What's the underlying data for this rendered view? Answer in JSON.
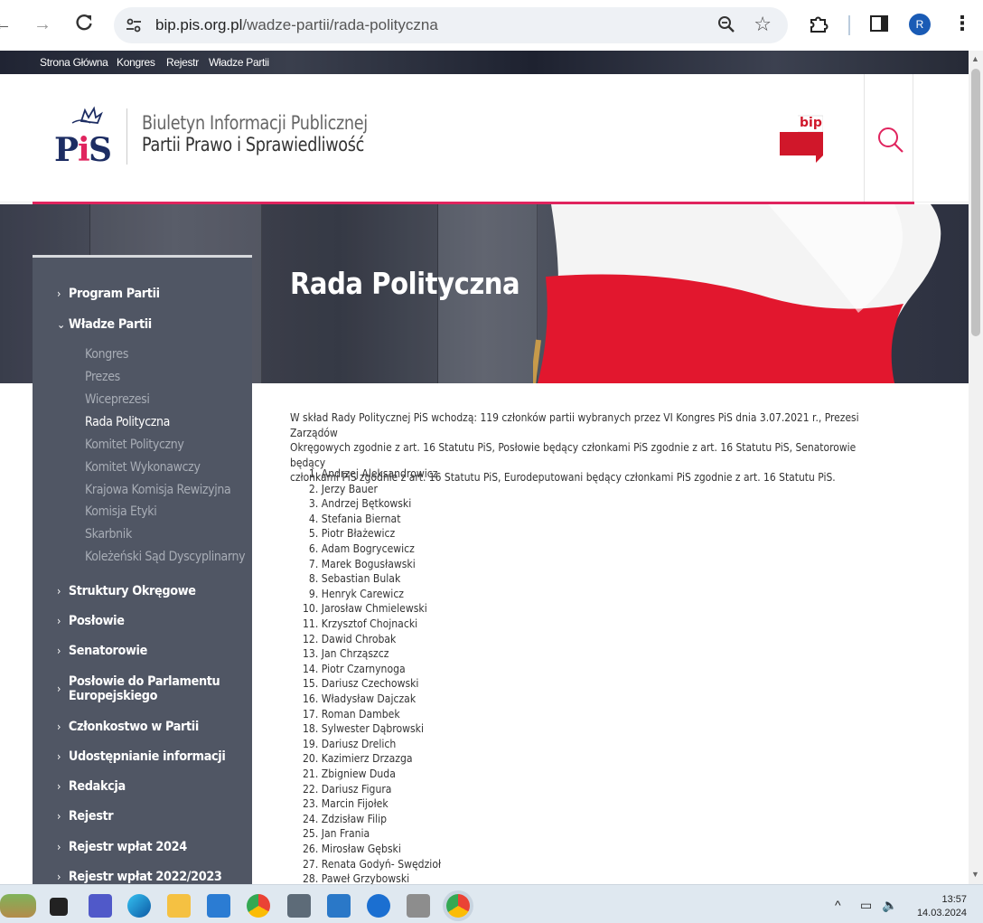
{
  "browser": {
    "url_domain": "bip.pis.org.pl",
    "url_path": "/wadze-partii/rada-polityczna",
    "profile_initial": "R"
  },
  "topnav": [
    "Strona Główna",
    "Kongres",
    "Rejestr",
    "Władze Partii"
  ],
  "header": {
    "logo_text": "PiS",
    "title_line1": "Biuletyn Informacji Publicznej",
    "title_line2": "Partii Prawo i Sprawiedliwość",
    "bip_label": "bip"
  },
  "hero": {
    "title": "Rada Polityczna"
  },
  "sidebar": {
    "items": [
      {
        "label": "Program Partii",
        "chevron": "›"
      },
      {
        "label": "Władze Partii",
        "chevron": "⌄"
      }
    ],
    "subitems": [
      {
        "label": "Kongres",
        "active": false
      },
      {
        "label": "Prezes",
        "active": false
      },
      {
        "label": "Wiceprezesi",
        "active": false
      },
      {
        "label": "Rada Polityczna",
        "active": true
      },
      {
        "label": "Komitet Polityczny",
        "active": false
      },
      {
        "label": "Komitet Wykonawczy",
        "active": false
      },
      {
        "label": "Krajowa Komisja Rewizyjna",
        "active": false
      },
      {
        "label": "Komisja Etyki",
        "active": false
      },
      {
        "label": "Skarbnik",
        "active": false
      },
      {
        "label": "Koleżeński Sąd Dyscyplinarny",
        "active": false
      }
    ],
    "items_after": [
      {
        "label": "Struktury Okręgowe"
      },
      {
        "label": "Posłowie"
      },
      {
        "label": "Senatorowie"
      },
      {
        "label": "Posłowie do Parlamentu",
        "label2": "Europejskiego"
      },
      {
        "label": "Członkostwo w Partii"
      },
      {
        "label": "Udostępnianie informacji"
      },
      {
        "label": "Redakcja"
      },
      {
        "label": "Rejestr"
      },
      {
        "label": "Rejestr wpłat 2024"
      },
      {
        "label": "Rejestr wpłat 2022/2023"
      }
    ]
  },
  "content": {
    "intro_lines": [
      "W skład Rady Politycznej PiS wchodzą: 119 członków partii wybranych przez VI Kongres PiS dnia 3.07.2021 r., Prezesi Zarządów",
      "Okręgowych zgodnie z art. 16 Statutu PiS, Posłowie będący członkami PiS zgodnie z art. 16 Statutu PiS, Senatorowie będący",
      "członkami PiS zgodnie z art. 16 Statutu PiS, Eurodeputowani będący członkami PiS zgodnie z art. 16 Statutu PiS."
    ],
    "members": [
      "Andrzej Aleksandrowicz",
      "Jerzy Bauer",
      "Andrzej Bętkowski",
      "Stefania Biernat",
      "Piotr Błażewicz",
      "Adam Bogrycewicz",
      "Marek Bogusławski",
      "Sebastian Bulak",
      "Henryk Carewicz",
      "Jarosław Chmielewski",
      "Krzysztof Chojnacki",
      "Dawid Chrobak",
      "Jan Chrząszcz",
      "Piotr Czarnynoga",
      "Dariusz Czechowski",
      "Władysław Dajczak",
      "Roman Dambek",
      "Sylwester Dąbrowski",
      "Dariusz Drelich",
      "Kazimierz Drzazga",
      "Zbigniew Duda",
      "Dariusz Figura",
      "Marcin Fijołek",
      "Zdzisław Filip",
      "Jan Frania",
      "Mirosław Gębski",
      "Renata Godyń- Swędzioł",
      "Paweł Grzybowski"
    ]
  },
  "taskbar": {
    "time": "13:57",
    "date": "14.03.2024"
  }
}
